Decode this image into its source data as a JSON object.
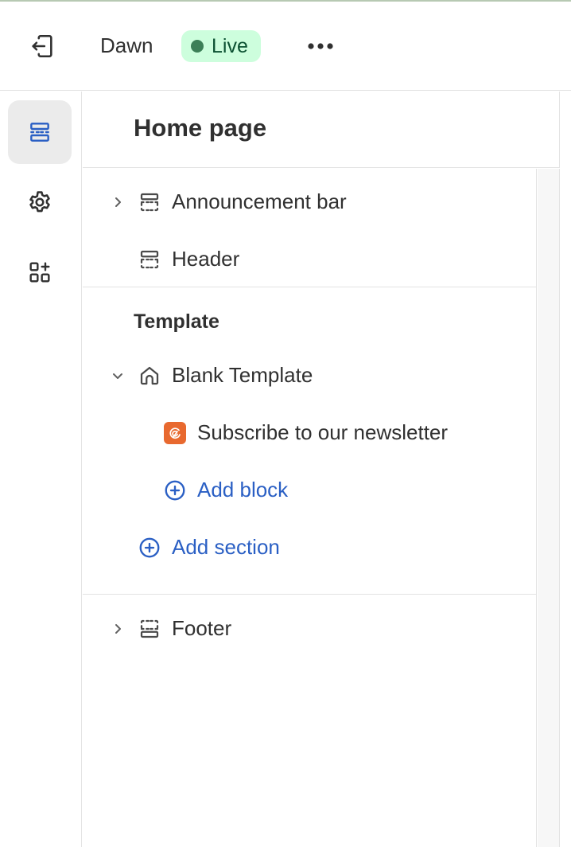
{
  "topbar": {
    "theme_name": "Dawn",
    "status_label": "Live",
    "status_colors": {
      "bg": "#cdfedd",
      "dot": "#3c7f57",
      "text": "#0c5132"
    }
  },
  "rail": {
    "items": [
      {
        "icon": "sections-icon",
        "active": true
      },
      {
        "icon": "gear-icon",
        "active": false
      },
      {
        "icon": "apps-icon",
        "active": false
      }
    ]
  },
  "panel": {
    "title": "Home page",
    "header_group": [
      {
        "label": "Announcement bar",
        "icon": "section-dashed-top-icon",
        "expandable": true
      },
      {
        "label": "Header",
        "icon": "section-dashed-top-icon",
        "expandable": false
      }
    ],
    "template": {
      "title": "Template",
      "section": {
        "label": "Blank Template",
        "icon": "home-icon",
        "expanded": true
      },
      "blocks": [
        {
          "label": "Subscribe to our newsletter",
          "icon": "app-block-icon",
          "icon_color": "#e8692f"
        }
      ],
      "add_block_label": "Add block",
      "add_section_label": "Add section"
    },
    "footer_group": [
      {
        "label": "Footer",
        "icon": "section-dashed-bottom-icon",
        "expandable": true
      }
    ]
  },
  "colors": {
    "accent_link": "#2a5fc4",
    "rail_active_icon": "#2a5fc4"
  }
}
